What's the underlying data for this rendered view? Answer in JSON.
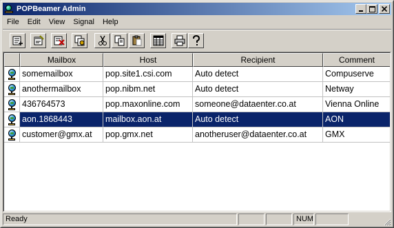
{
  "window": {
    "title": "POPBeamer Admin",
    "title_bar_color": "#0a246a",
    "buttons": [
      "minimize",
      "maximize",
      "close"
    ]
  },
  "menu": [
    "File",
    "Edit",
    "View",
    "Signal",
    "Help"
  ],
  "toolbar": {
    "buttons": [
      {
        "icon": "new-entry-icon"
      },
      {
        "icon": "properties-icon"
      },
      {
        "icon": "delete-entry-icon"
      },
      {
        "icon": "copy-entry-icon"
      },
      {
        "icon": "cut-icon"
      },
      {
        "icon": "copy-icon"
      },
      {
        "icon": "paste-icon"
      },
      {
        "icon": "list-view-icon"
      },
      {
        "icon": "print-icon"
      },
      {
        "icon": "help-icon"
      }
    ]
  },
  "list": {
    "columns": [
      "",
      "Mailbox",
      "Host",
      "Recipient",
      "Comment"
    ],
    "rows": [
      {
        "mailbox": "somemailbox",
        "host": "pop.site1.csi.com",
        "recipient": "Auto detect",
        "comment": "Compuserve",
        "selected": false
      },
      {
        "mailbox": "anothermailbox",
        "host": "pop.nibm.net",
        "recipient": "Auto detect",
        "comment": "Netway",
        "selected": false
      },
      {
        "mailbox": "436764573",
        "host": "pop.maxonline.com",
        "recipient": "someone@dataenter.co.at",
        "comment": "Vienna Online",
        "selected": false
      },
      {
        "mailbox": "aon.1868443",
        "host": "mailbox.aon.at",
        "recipient": "Auto detect",
        "comment": "AON",
        "selected": true
      },
      {
        "mailbox": "customer@gmx.at",
        "host": "pop.gmx.net",
        "recipient": "anotheruser@dataenter.co.at",
        "comment": "GMX",
        "selected": false
      }
    ],
    "selection_color": "#0a246a"
  },
  "status": {
    "text": "Ready",
    "panels": [
      "",
      "",
      "NUM",
      ""
    ]
  }
}
